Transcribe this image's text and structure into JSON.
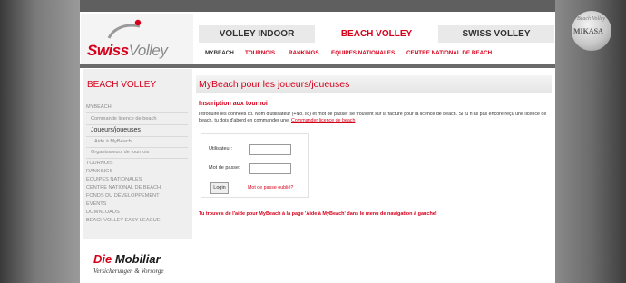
{
  "logo": {
    "swiss": "Swiss",
    "volley": "Volley"
  },
  "background": {
    "ball_brand": "MIKASA",
    "ball_script": "Beach Volley"
  },
  "tabs": [
    {
      "label": "VOLLEY INDOOR",
      "active": false
    },
    {
      "label": "BEACH VOLLEY",
      "active": true
    },
    {
      "label": "SWISS VOLLEY",
      "active": false
    }
  ],
  "subnav": [
    "MYBEACH",
    "TOURNOIS",
    "RANKINGS",
    "EQUIPES NATIONALES",
    "CENTRE NATIONAL DE BEACH"
  ],
  "sidebar": {
    "title": "BEACH VOLLEY",
    "items": [
      {
        "label": "MYBEACH",
        "level": 1
      },
      {
        "label": "Commande licence de beach",
        "level": 2
      },
      {
        "label": "Joueurs/joueuses",
        "level": 2,
        "current": true
      },
      {
        "label": "Aide à MyBeach",
        "level": 3
      },
      {
        "label": "Organisateurs de tournois",
        "level": 2
      },
      {
        "label": "TOURNOIS",
        "level": 1
      },
      {
        "label": "RANKINGS",
        "level": 1
      },
      {
        "label": "EQUIPES NATIONALES",
        "level": 1
      },
      {
        "label": "CENTRE NATIONAL DE BEACH",
        "level": 1
      },
      {
        "label": "FONDS DU DÉVELOPPEMENT",
        "level": 1
      },
      {
        "label": "EVENTS",
        "level": 1
      },
      {
        "label": "DOWNLOADS",
        "level": 1
      },
      {
        "label": "BEACHVOLLEY EASY LEAGUE",
        "level": 1
      }
    ]
  },
  "sponsor": {
    "die": "Die",
    "mobiliar": "Mobiliar",
    "tagline": "Versicherungen & Vorsorge"
  },
  "main": {
    "title": "MyBeach pour les joueurs/joueuses",
    "section_title": "Inscription aux tournoi",
    "intro_text": "Introduire les données ici. Nom d'utilisateur (+No. lic) et mot de passe\" se trouvent sur la facture pour la licence de beach. Si tu n'as pas encore reçu une licence de beach, tu dois d'abord en commander une.",
    "intro_link": "Commander licence de beach",
    "form": {
      "user_label": "Utilisateur:",
      "user_value": "",
      "password_label": "Mot de passe:",
      "password_value": "",
      "login_label": "Login",
      "forgot_label": "Mot de passe oublié?"
    },
    "help_text": "Tu trouves de l'aide pour MyBeach à la page 'Aide à MyBeach' dans le menu de navigation à gauche!"
  },
  "colors": {
    "accent": "#d7001b",
    "tab_bg": "#e9e9e9",
    "sidebar_bg": "#efefef"
  }
}
